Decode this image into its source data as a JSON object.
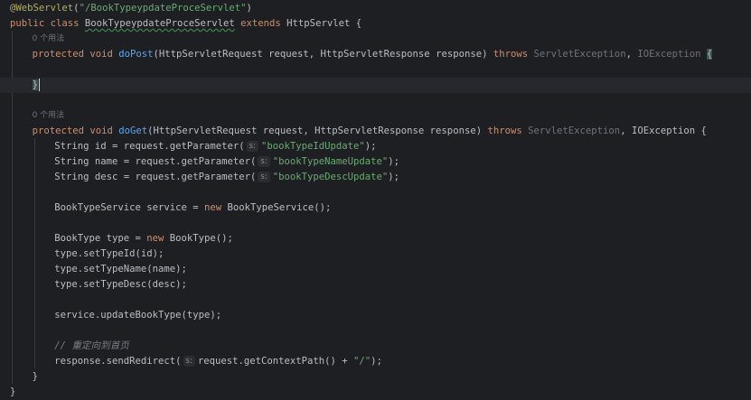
{
  "editor": {
    "lines": [
      {
        "indent": 0,
        "tokens": [
          {
            "t": "@WebServlet",
            "c": "annot"
          },
          {
            "t": "(",
            "c": "plain"
          },
          {
            "t": "\"/BookTypeypdateProceServlet\"",
            "c": "str"
          },
          {
            "t": ")",
            "c": "plain"
          }
        ]
      },
      {
        "indent": 0,
        "tokens": [
          {
            "t": "public class ",
            "c": "kw"
          },
          {
            "t": "BookTypeypdateProceServlet",
            "c": "plain",
            "underline": true
          },
          {
            "t": " ",
            "c": "plain"
          },
          {
            "t": "extends",
            "c": "kw"
          },
          {
            "t": " HttpServlet {",
            "c": "plain"
          }
        ]
      },
      {
        "indent": 1,
        "hint": true,
        "tokens": [
          {
            "t": "0 个用法",
            "c": "dim"
          }
        ]
      },
      {
        "indent": 1,
        "tokens": [
          {
            "t": "protected void ",
            "c": "kw"
          },
          {
            "t": "doPost",
            "c": "fn"
          },
          {
            "t": "(HttpServletRequest request, HttpServletResponse response) ",
            "c": "plain"
          },
          {
            "t": "throws",
            "c": "kw"
          },
          {
            "t": " ServletException",
            "c": "dim"
          },
          {
            "t": ", ",
            "c": "plain"
          },
          {
            "t": "IOException",
            "c": "dim"
          },
          {
            "t": " ",
            "c": "plain"
          },
          {
            "t": "{",
            "c": "plain",
            "highlight": true
          }
        ]
      },
      {
        "indent": 0,
        "tokens": []
      },
      {
        "indent": 1,
        "current": true,
        "tokens": [
          {
            "t": "}",
            "c": "plain",
            "highlight": true
          }
        ]
      },
      {
        "indent": 0,
        "tokens": []
      },
      {
        "indent": 1,
        "hint": true,
        "tokens": [
          {
            "t": "0 个用法",
            "c": "dim"
          }
        ]
      },
      {
        "indent": 1,
        "tokens": [
          {
            "t": "protected void ",
            "c": "kw"
          },
          {
            "t": "doGet",
            "c": "fn"
          },
          {
            "t": "(HttpServletRequest request, HttpServletResponse response) ",
            "c": "plain"
          },
          {
            "t": "throws",
            "c": "kw"
          },
          {
            "t": " ServletException",
            "c": "dim"
          },
          {
            "t": ", IOException {",
            "c": "plain"
          }
        ]
      },
      {
        "indent": 2,
        "tokens": [
          {
            "t": "String id = request.getParameter(",
            "c": "plain"
          },
          {
            "t": "s:",
            "c": "hint"
          },
          {
            "t": "\"bookTypeIdUpdate\"",
            "c": "str"
          },
          {
            "t": ");",
            "c": "plain"
          }
        ]
      },
      {
        "indent": 2,
        "tokens": [
          {
            "t": "String name = request.getParameter(",
            "c": "plain"
          },
          {
            "t": "s:",
            "c": "hint"
          },
          {
            "t": "\"bookTypeNameUpdate\"",
            "c": "str"
          },
          {
            "t": ");",
            "c": "plain"
          }
        ]
      },
      {
        "indent": 2,
        "tokens": [
          {
            "t": "String desc = request.getParameter(",
            "c": "plain"
          },
          {
            "t": "s:",
            "c": "hint"
          },
          {
            "t": "\"bookTypeDescUpdate\"",
            "c": "str"
          },
          {
            "t": ");",
            "c": "plain"
          }
        ]
      },
      {
        "indent": 0,
        "tokens": []
      },
      {
        "indent": 2,
        "tokens": [
          {
            "t": "BookTypeService service = ",
            "c": "plain"
          },
          {
            "t": "new",
            "c": "kw"
          },
          {
            "t": " BookTypeService();",
            "c": "plain"
          }
        ]
      },
      {
        "indent": 0,
        "tokens": []
      },
      {
        "indent": 2,
        "tokens": [
          {
            "t": "BookType type = ",
            "c": "plain"
          },
          {
            "t": "new",
            "c": "kw"
          },
          {
            "t": " BookType();",
            "c": "plain"
          }
        ]
      },
      {
        "indent": 2,
        "tokens": [
          {
            "t": "type.setTypeId(id);",
            "c": "plain"
          }
        ]
      },
      {
        "indent": 2,
        "tokens": [
          {
            "t": "type.setTypeName(name);",
            "c": "plain"
          }
        ]
      },
      {
        "indent": 2,
        "tokens": [
          {
            "t": "type.setTypeDesc(desc);",
            "c": "plain"
          }
        ]
      },
      {
        "indent": 0,
        "tokens": []
      },
      {
        "indent": 2,
        "tokens": [
          {
            "t": "service.updateBookType(type);",
            "c": "plain"
          }
        ]
      },
      {
        "indent": 0,
        "tokens": []
      },
      {
        "indent": 2,
        "tokens": [
          {
            "t": "// 重定向到首页",
            "c": "com"
          }
        ]
      },
      {
        "indent": 2,
        "tokens": [
          {
            "t": "response.sendRedirect(",
            "c": "plain"
          },
          {
            "t": "s:",
            "c": "hint"
          },
          {
            "t": "request.getContextPath() + ",
            "c": "plain"
          },
          {
            "t": "\"/\"",
            "c": "str"
          },
          {
            "t": ");",
            "c": "plain"
          }
        ]
      },
      {
        "indent": 1,
        "tokens": [
          {
            "t": "}",
            "c": "plain"
          }
        ]
      },
      {
        "indent": 0,
        "tokens": [
          {
            "t": "}",
            "c": "plain"
          }
        ]
      }
    ]
  }
}
